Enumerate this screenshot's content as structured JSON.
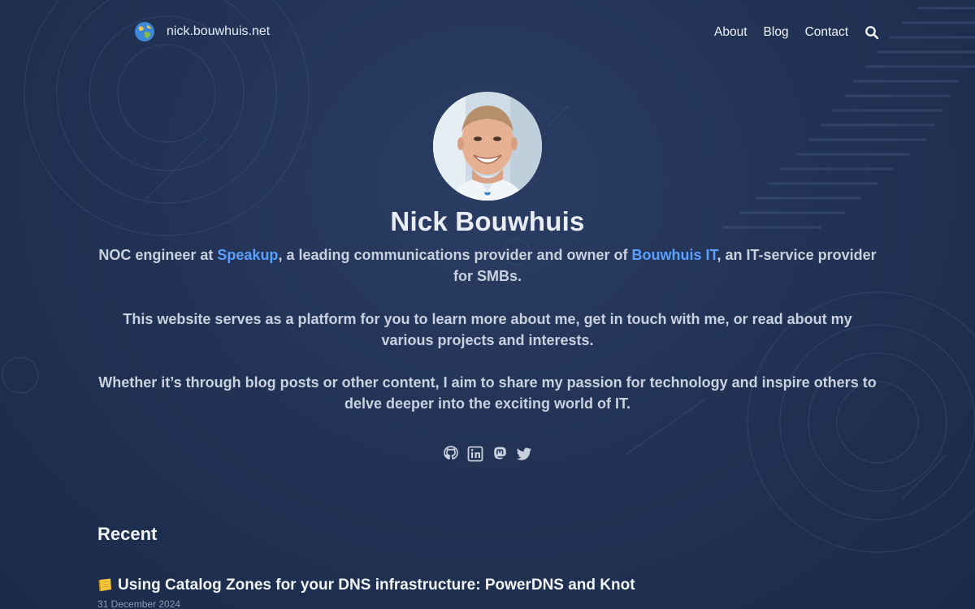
{
  "site": {
    "brand": "nick.bouwhuis.net"
  },
  "nav": {
    "items": [
      "About",
      "Blog",
      "Contact"
    ]
  },
  "profile": {
    "name": "Nick Bouwhuis",
    "p1_before": "NOC engineer at ",
    "p1_link1": "Speakup",
    "p1_middle": ", a leading communications provider and owner of ",
    "p1_link2": "Bouwhuis IT",
    "p1_after": ", an IT-service provider for SMBs.",
    "p2": "This website serves as a platform for you to learn more about me, get in touch with me, or read about my various projects and interests.",
    "p3": "Whether it’s through blog posts or other content, I aim to share my passion for technology and inspire others to delve deeper into the exciting world of IT."
  },
  "socials": [
    "github-icon",
    "linkedin-icon",
    "mastodon-icon",
    "twitter-icon"
  ],
  "recent": {
    "heading": "Recent",
    "posts": [
      {
        "title": "Using Catalog Zones for your DNS infrastructure: PowerDNS and Knot",
        "date": "31 December 2024",
        "emoji": "ledger-icon"
      }
    ]
  },
  "colors": {
    "background": "#223356",
    "link": "#5aa0ff",
    "text": "#e6ebf2",
    "muted": "#c8d1dd"
  }
}
